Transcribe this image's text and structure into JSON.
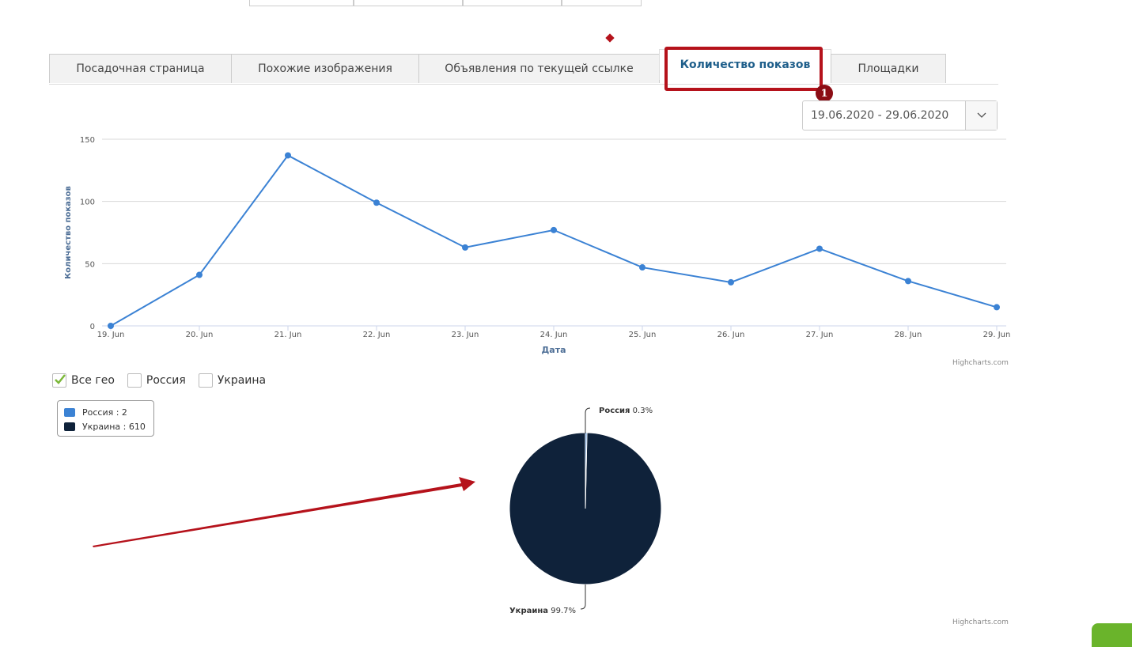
{
  "tabs": [
    {
      "label": "Посадочная страница",
      "active": false
    },
    {
      "label": "Похожие изображения",
      "active": false
    },
    {
      "label": "Объявления по текущей ссылке",
      "active": false
    },
    {
      "label": "Количество показов",
      "active": true
    },
    {
      "label": "Площадки",
      "active": false
    }
  ],
  "annotation": {
    "badge": "1",
    "color": "#b5121b"
  },
  "date_range": {
    "value": "19.06.2020 - 29.06.2020"
  },
  "geo_filters": [
    {
      "label": "Все гео",
      "checked": true
    },
    {
      "label": "Россия",
      "checked": false
    },
    {
      "label": "Украина",
      "checked": false
    }
  ],
  "credits": {
    "line_chart": "Highcharts.com",
    "pie_chart": "Highcharts.com"
  },
  "pie_legend": [
    {
      "label": "Россия : 2",
      "color": "#3b82d4"
    },
    {
      "label": "Украина : 610",
      "color": "#0f223a"
    }
  ],
  "chart_data": [
    {
      "type": "line",
      "categories": [
        "19. Jun",
        "20. Jun",
        "21. Jun",
        "22. Jun",
        "23. Jun",
        "24. Jun",
        "25. Jun",
        "26. Jun",
        "27. Jun",
        "28. Jun",
        "29. Jun"
      ],
      "series": [
        {
          "values": [
            0,
            41,
            137,
            99,
            63,
            77,
            47,
            35,
            62,
            36,
            15
          ],
          "color": "#3b82d4"
        }
      ],
      "xlabel": "Дата",
      "ylabel": "Количество показов",
      "yticks": [
        "0",
        "50",
        "100",
        "150"
      ],
      "ylim": [
        0,
        150
      ],
      "grid": true
    },
    {
      "type": "pie",
      "slices": [
        {
          "name": "Россия",
          "value": 2,
          "percent": "0.3%",
          "color": "#3b82d4"
        },
        {
          "name": "Украина",
          "value": 610,
          "percent": "99.7%",
          "color": "#0f223a"
        }
      ]
    }
  ]
}
